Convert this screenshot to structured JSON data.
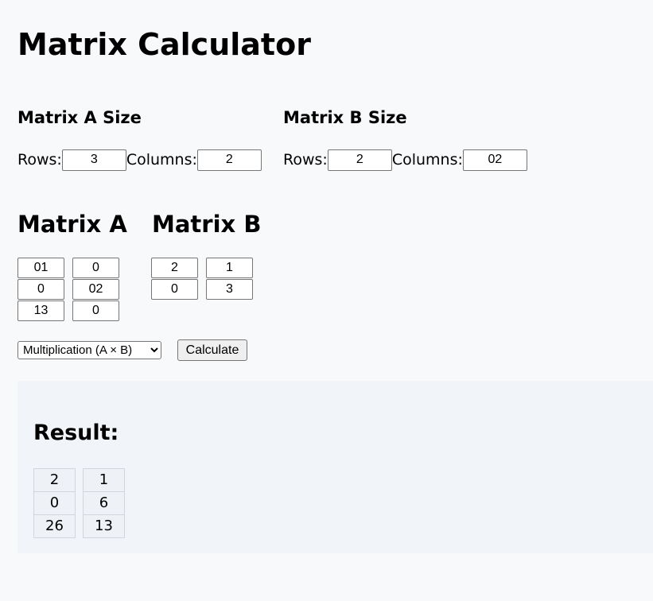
{
  "page": {
    "title": "Matrix Calculator"
  },
  "size_a": {
    "heading": "Matrix A Size",
    "rows_label": "Rows:",
    "rows_value": "3",
    "cols_label": "Columns:",
    "cols_value": "2"
  },
  "size_b": {
    "heading": "Matrix B Size",
    "rows_label": "Rows:",
    "rows_value": "2",
    "cols_label": "Columns:",
    "cols_value": "02"
  },
  "matrix_a": {
    "heading": "Matrix A",
    "cells": [
      [
        "01",
        "0"
      ],
      [
        "0",
        "02"
      ],
      [
        "13",
        "0"
      ]
    ]
  },
  "matrix_b": {
    "heading": "Matrix B",
    "cells": [
      [
        "2",
        "1"
      ],
      [
        "0",
        "3"
      ]
    ]
  },
  "controls": {
    "operation_selected": "Multiplication (A × B)",
    "calculate_label": "Calculate"
  },
  "result": {
    "heading": "Result:",
    "cells": [
      [
        "2",
        "1"
      ],
      [
        "0",
        "6"
      ],
      [
        "26",
        "13"
      ]
    ]
  }
}
